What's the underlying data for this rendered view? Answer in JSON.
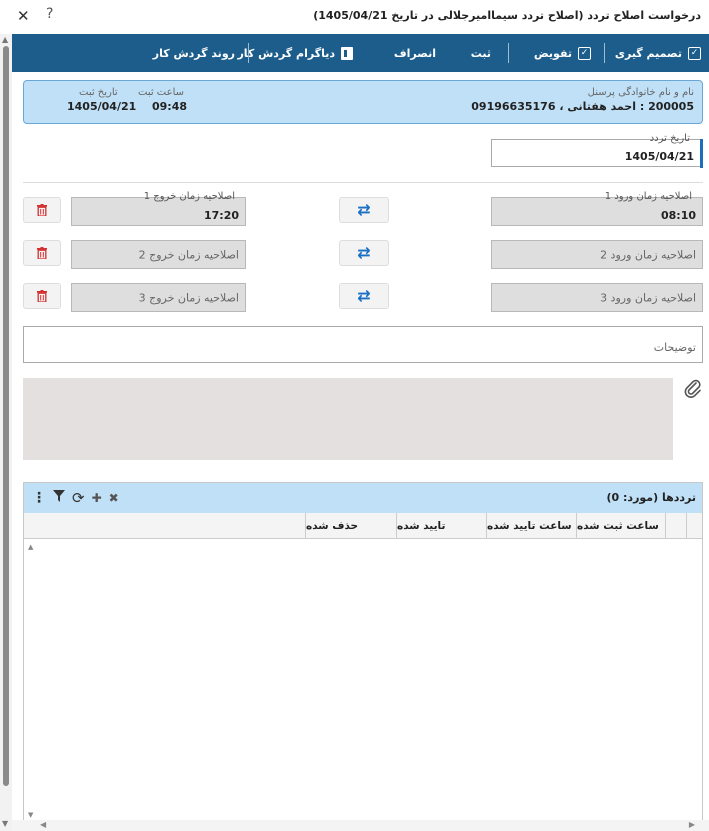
{
  "window": {
    "title": "درخواست اصلاح تردد (اصلاح تردد سیماامیرجلالی در تاریخ 1405/04/21)",
    "close_glyph": "✕",
    "help_glyph": "?"
  },
  "toolbar": {
    "decide": "تصمیم گیری",
    "delegate": "تفویض",
    "register": "ثبت",
    "cancel": "انصراف",
    "diagram": "دیاگرام گردش کار",
    "workflow": "روند گردش کار"
  },
  "info": {
    "person_label": "نام و نام خانوادگی پرسنل",
    "person_value": "200005 : احمد هفتانی ، 09196635176",
    "time_label": "ساعت ثبت",
    "time_value": "09:48",
    "date_label": "تاریخ ثبت",
    "date_value": "1405/04/21"
  },
  "traffic_date": {
    "label": "تاریخ تردد",
    "value": "1405/04/21"
  },
  "rows": [
    {
      "entry_label": "اصلاحیه زمان ورود 1",
      "entry_value": "08:10",
      "exit_label": "اصلاحیه زمان خروج 1",
      "exit_value": "17:20"
    },
    {
      "entry_placeholder": "اصلاحیه زمان ورود 2",
      "exit_placeholder": "اصلاحیه زمان خروج 2"
    },
    {
      "entry_placeholder": "اصلاحیه زمان ورود 3",
      "exit_placeholder": "اصلاحیه زمان خروج 3"
    }
  ],
  "description": {
    "placeholder": "توضیحات"
  },
  "grid": {
    "title": "ترددها (مورد: 0)",
    "columns": [
      "ساعت ثبت شده",
      "ساعت تایید شده",
      "تایید شده",
      "حذف شده"
    ]
  },
  "icons": {
    "swap": "swap-arrows-icon",
    "trash": "trash-icon",
    "attach": "paperclip-icon"
  },
  "colors": {
    "toolbar_bg": "#1c5d8c",
    "info_bg": "#bfe0f7",
    "swap_blue": "#1a6fc4",
    "trash_red": "#d32f2f"
  }
}
